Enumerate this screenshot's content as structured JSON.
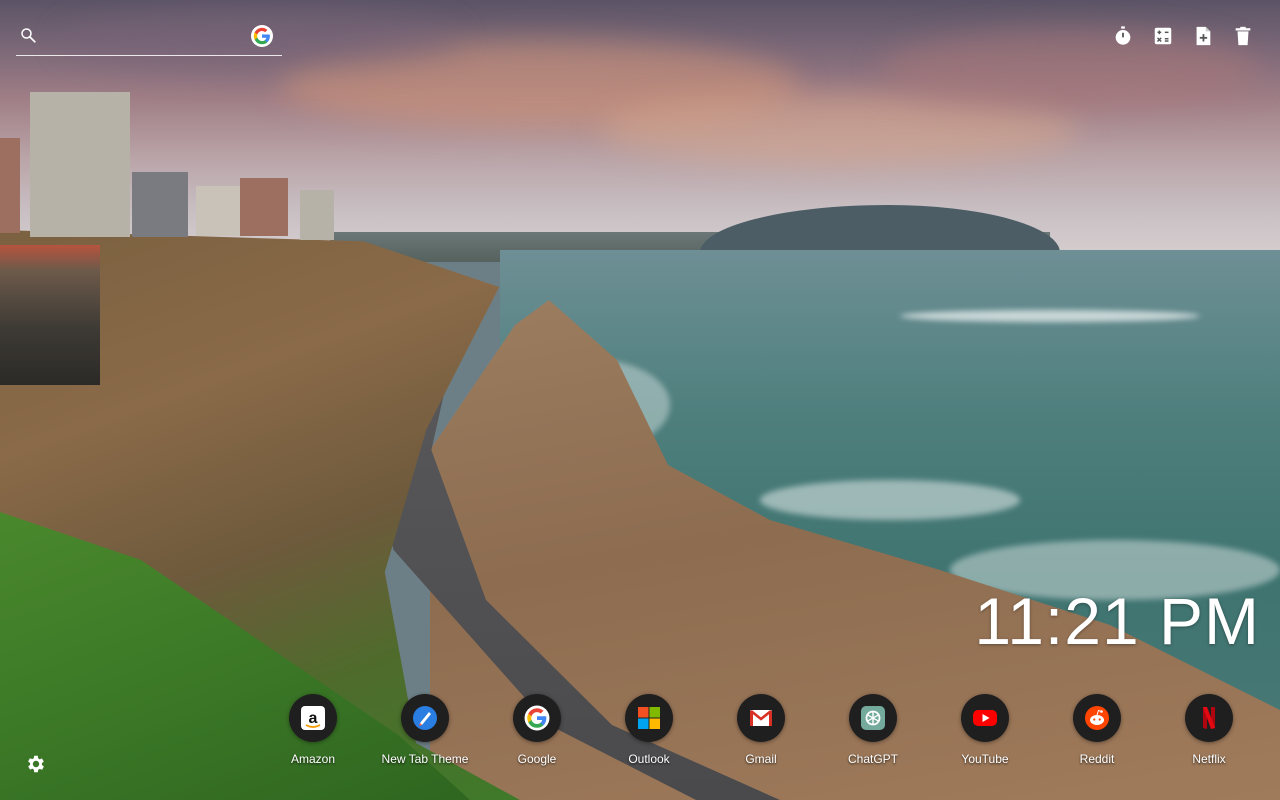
{
  "search": {
    "placeholder": "",
    "icon": "search-icon",
    "engine_icon": "google-icon"
  },
  "tools": [
    {
      "name": "timer-icon"
    },
    {
      "name": "calculator-icon"
    },
    {
      "name": "new-note-icon"
    },
    {
      "name": "trash-icon"
    }
  ],
  "clock": {
    "time": "11:21 PM"
  },
  "shortcuts": [
    {
      "label": "Amazon",
      "icon": "amazon-icon"
    },
    {
      "label": "New Tab Theme",
      "icon": "new-tab-theme-icon"
    },
    {
      "label": "Google",
      "icon": "google-icon"
    },
    {
      "label": "Outlook",
      "icon": "outlook-icon"
    },
    {
      "label": "Gmail",
      "icon": "gmail-icon"
    },
    {
      "label": "ChatGPT",
      "icon": "chatgpt-icon"
    },
    {
      "label": "YouTube",
      "icon": "youtube-icon"
    },
    {
      "label": "Reddit",
      "icon": "reddit-icon"
    },
    {
      "label": "Netflix",
      "icon": "netflix-icon"
    }
  ],
  "settings": {
    "icon": "gear-icon"
  },
  "colors": {
    "shortcut_bg": "#1f1f1f",
    "text": "#ffffff"
  }
}
